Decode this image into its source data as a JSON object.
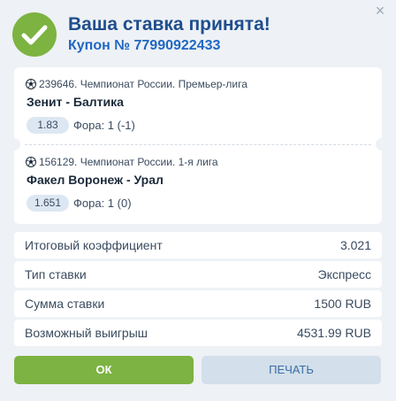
{
  "header": {
    "title": "Ваша ставка принята!",
    "coupon": "Купон № 77990922433"
  },
  "close_icon": "×",
  "bets": [
    {
      "league": "239646. Чемпионат России. Премьер-лига",
      "teams": "Зенит - Балтика",
      "odds": "1.83",
      "market": "Фора: 1 (-1)"
    },
    {
      "league": "156129. Чемпионат России. 1-я лига",
      "teams": "Факел Воронеж - Урал",
      "odds": "1.651",
      "market": "Фора: 1 (0)"
    }
  ],
  "summary": [
    {
      "label": "Итоговый коэффициент",
      "value": "3.021"
    },
    {
      "label": "Тип ставки",
      "value": "Экспресс"
    },
    {
      "label": "Сумма ставки",
      "value": "1500 RUB"
    },
    {
      "label": "Возможный выигрыш",
      "value": "4531.99 RUB"
    }
  ],
  "buttons": {
    "ok": "ОК",
    "print": "ПЕЧАТЬ"
  },
  "colors": {
    "accent_green": "#7cb341",
    "title_blue": "#1f4e8c",
    "coupon_blue": "#1f67c4",
    "print_bg": "#d3dfeb"
  },
  "icons": {
    "success": "checkmark-icon",
    "sport": "soccer-ball-icon",
    "close": "close-icon"
  }
}
